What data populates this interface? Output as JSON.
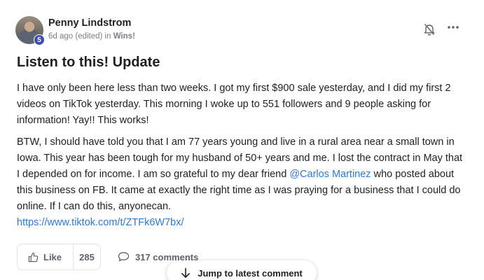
{
  "post": {
    "author": "Penny Lindstrom",
    "level": "5",
    "meta_prefix": "6d ago (edited) in ",
    "category": "Wins!",
    "title": "Listen to this! Update",
    "paragraph1": "I have only been here less than two weeks. I got my first $900 sale yesterday, and I did my first 2 videos on TikTok yesterday. This morning I woke up to 551 followers and 9 people asking for information! Yay!! This works!",
    "paragraph2_before": "BTW, I should have told you that I am 77 years young and live in a rural area near a small town in Iowa. This year has been tough for my husband of 50+ years and me. I lost the contract in May that I depended on for income. I am so grateful to my dear friend ",
    "mention": "@Carlos Martinez",
    "paragraph2_after": " who posted about this business on FB. It came at exactly the right time as I was praying for a business that I could do online. If I can do this, anyonecan.",
    "link": "https://www.tiktok.com/t/ZTFk6W7bx/"
  },
  "actions": {
    "like_label": "Like",
    "like_count": "285",
    "comments_label": "317 comments",
    "jump_label": "Jump to latest comment"
  },
  "icons": {
    "bell": "bell-off-icon",
    "more": "more-horizontal-icon",
    "like": "thumbs-up-icon",
    "comment": "comment-icon",
    "jump": "arrow-down-icon"
  },
  "colors": {
    "accent": "#2f78d4",
    "badge": "#3f4fb0"
  }
}
